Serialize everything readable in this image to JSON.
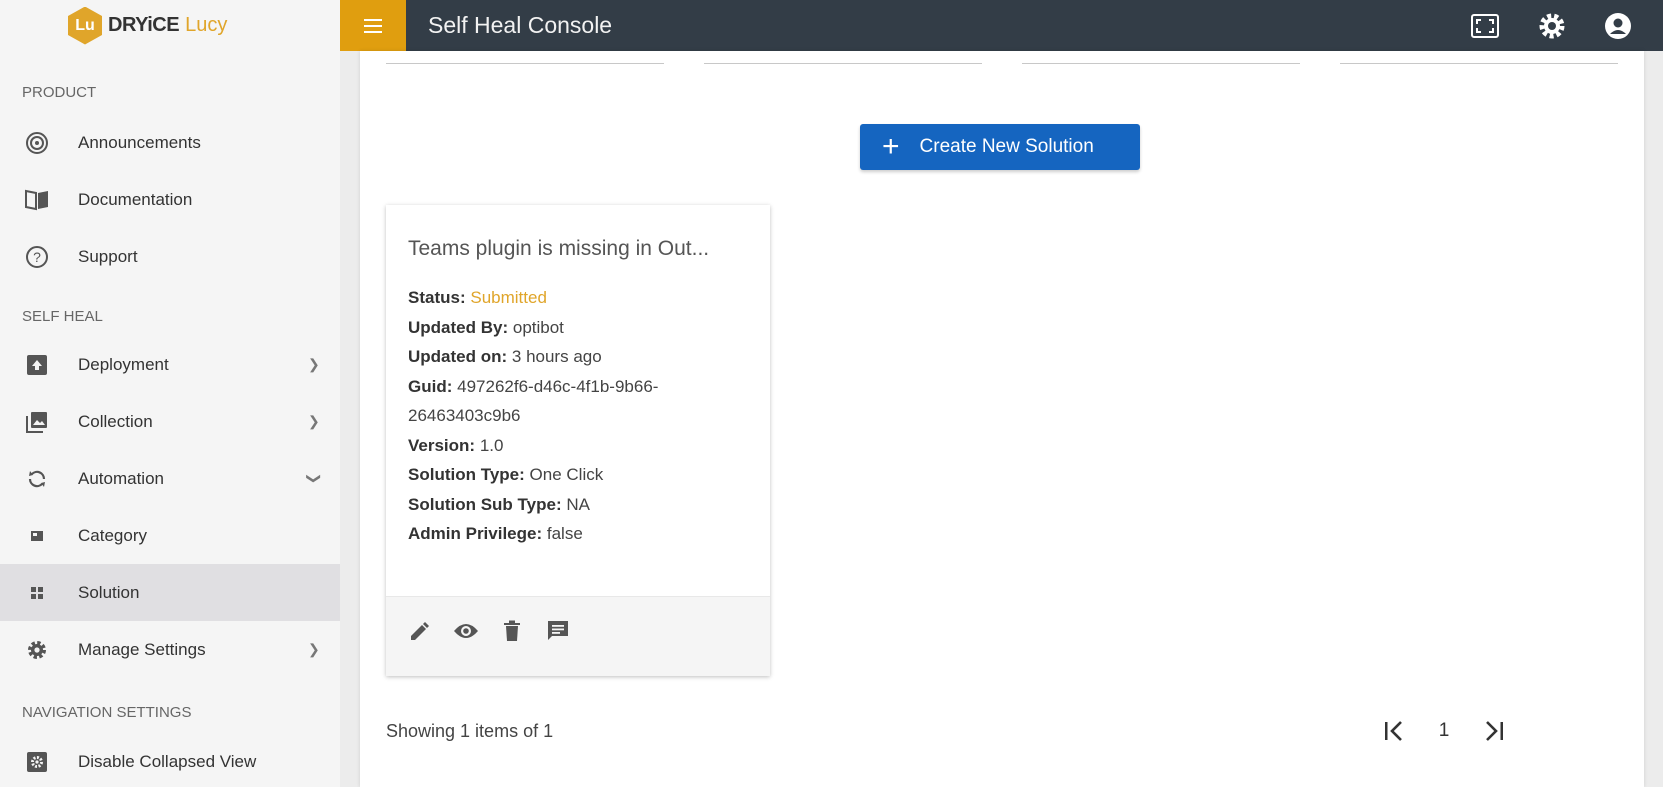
{
  "brand": {
    "logo_letters": "Lu",
    "name_main": "DRYiCE",
    "name_sub": "Lucy"
  },
  "topbar": {
    "title": "Self Heal Console"
  },
  "sidebar": {
    "sections": {
      "product": "PRODUCT",
      "self_heal": "SELF HEAL",
      "navigation_settings": "NAVIGATION SETTINGS"
    },
    "items": [
      {
        "label": "Announcements"
      },
      {
        "label": "Documentation"
      },
      {
        "label": "Support"
      },
      {
        "label": "Deployment"
      },
      {
        "label": "Collection"
      },
      {
        "label": "Automation"
      },
      {
        "label": "Category"
      },
      {
        "label": "Solution"
      },
      {
        "label": "Manage Settings"
      },
      {
        "label": "Disable Collapsed View"
      }
    ]
  },
  "main": {
    "create_button": "Create New Solution",
    "card": {
      "title": "Teams plugin is missing in Out...",
      "status_label": "Status:",
      "status_value": "Submitted",
      "updated_by_label": "Updated By:",
      "updated_by_value": "optibot",
      "updated_on_label": "Updated on:",
      "updated_on_value": "3 hours ago",
      "guid_label": "Guid:",
      "guid_value": "497262f6-d46c-4f1b-9b66-26463403c9b6",
      "version_label": "Version:",
      "version_value": "1.0",
      "solution_type_label": "Solution Type:",
      "solution_type_value": "One Click",
      "solution_sub_type_label": "Solution Sub Type:",
      "solution_sub_type_value": "NA",
      "admin_privilege_label": "Admin Privilege:",
      "admin_privilege_value": "false"
    },
    "pagination": {
      "showing_text": "Showing 1 items of 1",
      "current_page": "1"
    }
  },
  "colors": {
    "accent": "#e09e0f",
    "topbar": "#333d47",
    "primary_button": "#1565c0",
    "status_submitted": "#e0a52a"
  }
}
